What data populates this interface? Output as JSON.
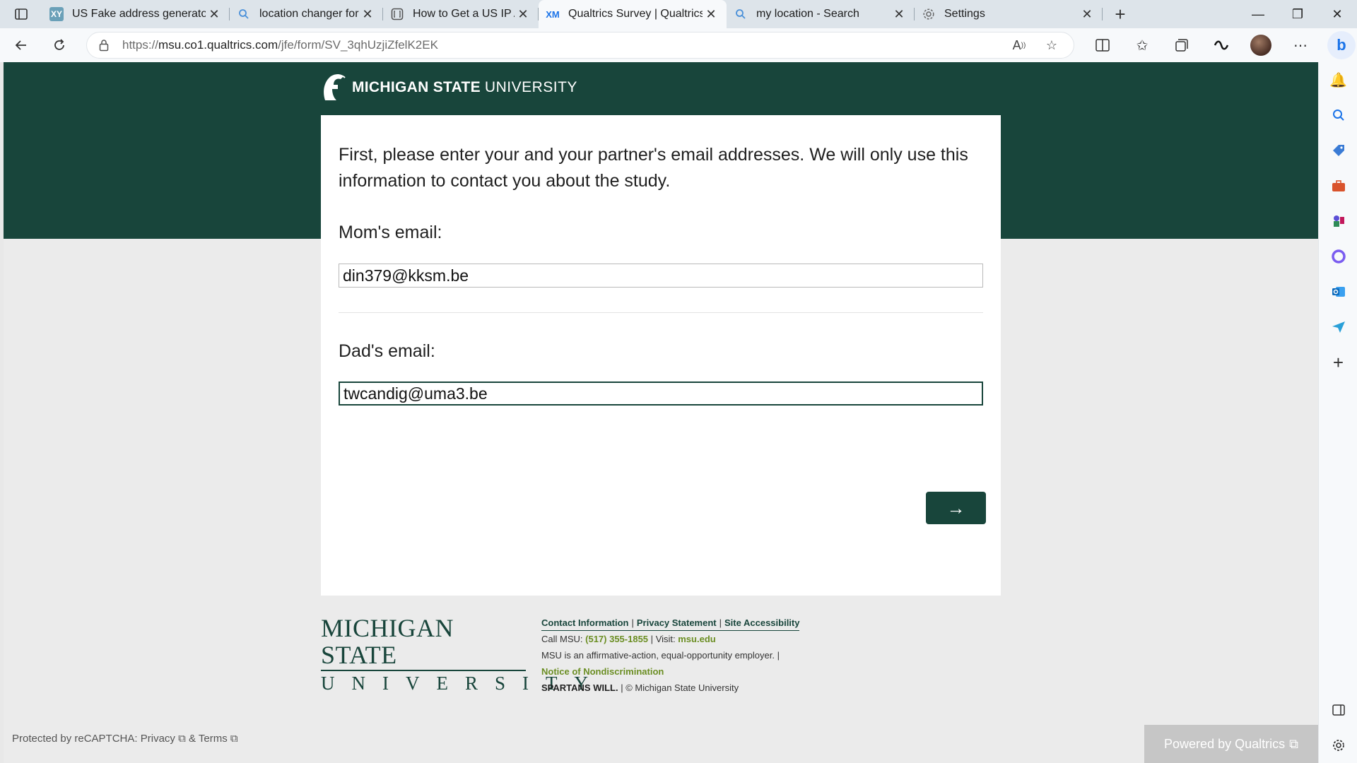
{
  "browser": {
    "tabs": [
      {
        "favicon": "xy-icon",
        "favicon_text": "XY",
        "title": "US Fake address generator",
        "active": false
      },
      {
        "favicon": "search-icon",
        "favicon_text": "",
        "title": "location changer for window",
        "active": false
      },
      {
        "favicon": "article-icon",
        "favicon_text": "",
        "title": "How to Get a US IP Address",
        "active": false
      },
      {
        "favicon": "qualtrics-icon",
        "favicon_text": "XM",
        "title": "Qualtrics Survey | Qualtrics E",
        "active": true
      },
      {
        "favicon": "search-icon",
        "favicon_text": "",
        "title": "my location - Search",
        "active": false
      },
      {
        "favicon": "gear-icon",
        "favicon_text": "",
        "title": "Settings",
        "active": false
      }
    ],
    "address": {
      "url_prefix": "https://",
      "url_host": "msu.co1.qualtrics.com",
      "url_path": "/jfe/form/SV_3qhUzjiZfelK2EK"
    }
  },
  "survey": {
    "brand_bold": "MICHIGAN STATE",
    "brand_light": "UNIVERSITY",
    "question_text": "First, please enter your and your partner's email addresses. We will only use this information to contact you about the study.",
    "mom_label": "Mom's email:",
    "mom_value": "din379@kksm.be",
    "dad_label": "Dad's email:",
    "dad_value": "twcandig@uma3.be",
    "next_label": "→"
  },
  "footer": {
    "logo_line1": "MICHIGAN STATE",
    "logo_line2": "UNIVERSITY",
    "link_contact": "Contact Information",
    "link_privacy": "Privacy Statement",
    "link_accessibility": "Site Accessibility",
    "call_prefix": "Call MSU:",
    "phone": "(517) 355-1855",
    "visit_prefix": "Visit:",
    "site": "msu.edu",
    "employer": "MSU is an affirmative-action, equal-opportunity employer.",
    "nondiscrimination": "Notice of Nondiscrimination",
    "spartans": "SPARTANS WILL.",
    "copyright": "© Michigan State University"
  },
  "page_footer": {
    "recaptcha_prefix": "Protected by reCAPTCHA:",
    "recaptcha_privacy": "Privacy",
    "recaptcha_and": "&",
    "recaptcha_terms": "Terms",
    "powered_by": "Powered by Qualtrics"
  },
  "colors": {
    "msu_green": "#18453b",
    "footer_link_green": "#6b8e23"
  }
}
